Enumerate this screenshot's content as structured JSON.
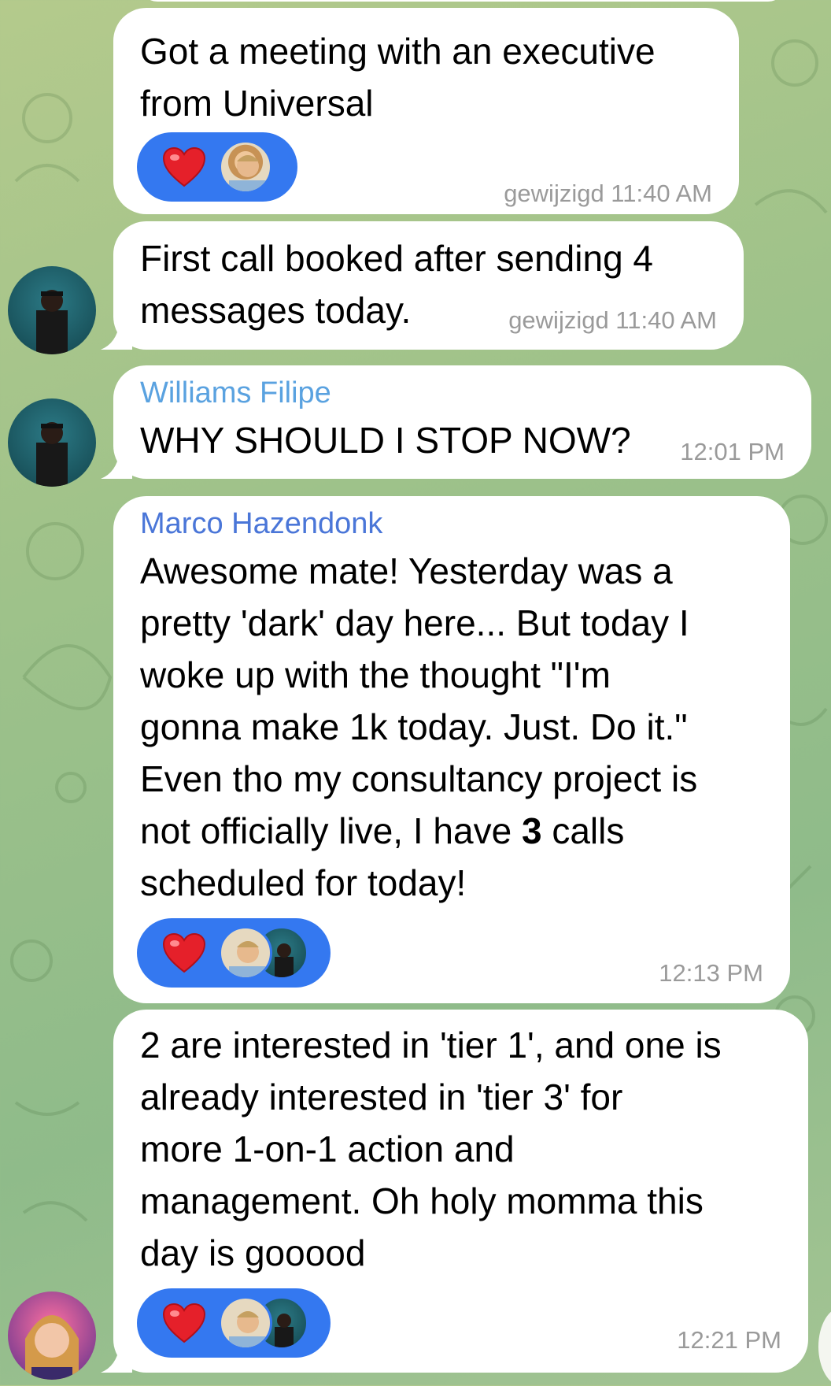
{
  "colors": {
    "reaction_bg": "#3478f0",
    "sender_williams": "#5aa2e0",
    "sender_marco": "#4a76d8"
  },
  "messages": [
    {
      "text": "Got a meeting with an executive\nfrom Universal",
      "meta": "gewijzigd 11:40 AM",
      "reactions": [
        "heart-emoji"
      ]
    },
    {
      "text": "First call booked after sending 4\nmessages today.",
      "meta": "gewijzigd 11:40 AM"
    },
    {
      "sender": "Williams Filipe",
      "text": "WHY SHOULD I STOP NOW?",
      "meta": "12:01 PM"
    },
    {
      "sender": "Marco Hazendonk",
      "text_before": "Awesome mate! Yesterday was a\npretty 'dark' day here... But today I\nwoke up with the thought \"I'm\ngonna make 1k today. Just. Do it.\"\nEven tho my consultancy project is\nnot officially live, I have ",
      "text_bold": "3",
      "text_after": " calls\nscheduled for today!",
      "meta": "12:13 PM",
      "reactions": [
        "heart-emoji"
      ]
    },
    {
      "text": "2 are interested in 'tier 1', and one is\nalready interested in 'tier 3' for\nmore 1-on-1 action and\nmanagement. Oh holy momma this\nday is gooood",
      "meta": "12:21 PM",
      "reactions": [
        "heart-emoji"
      ]
    }
  ]
}
